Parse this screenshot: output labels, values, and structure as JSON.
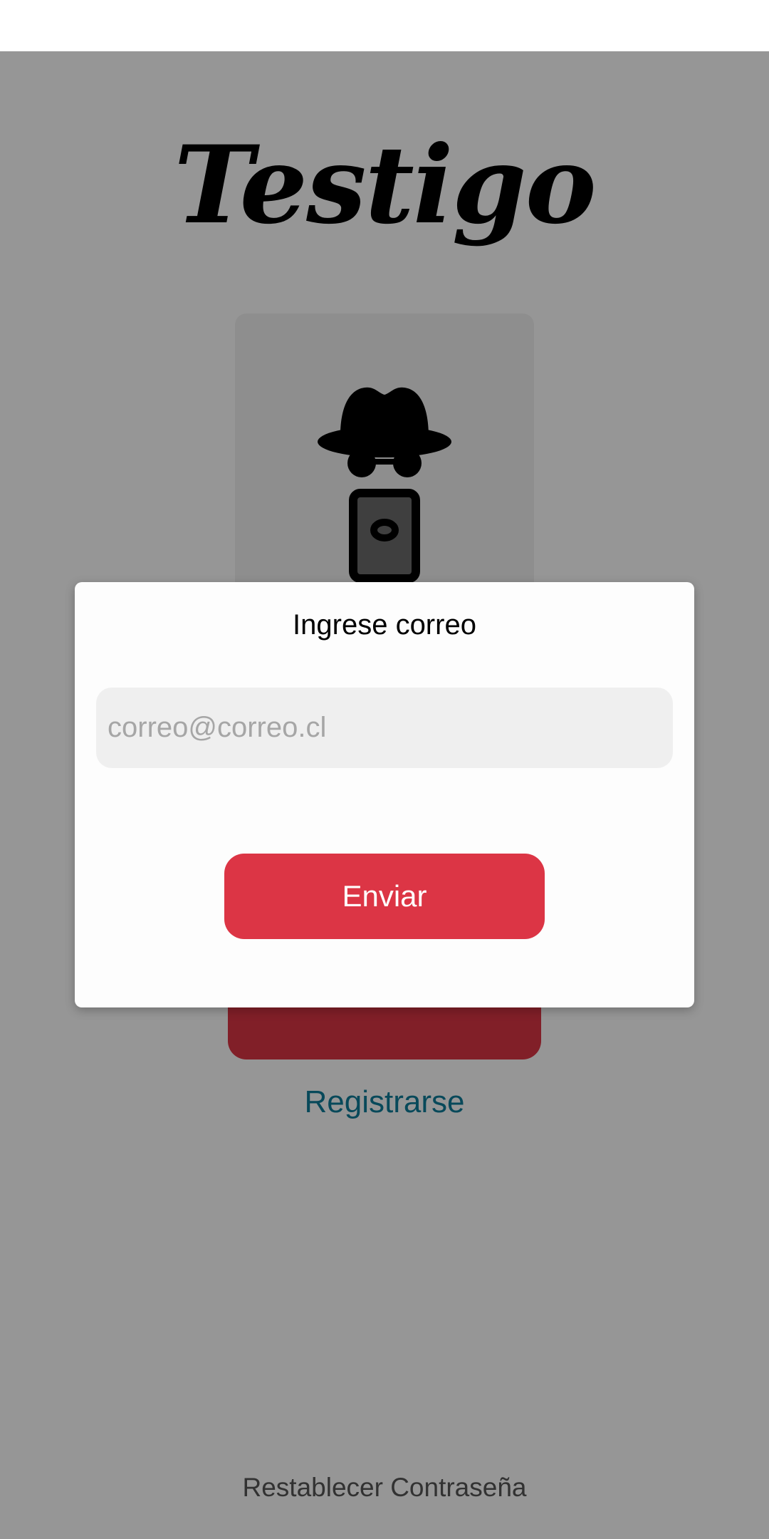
{
  "app": {
    "title": "Testigo"
  },
  "main": {
    "logo_icon": "spy-phone-icon",
    "login_button_label": "",
    "register_link": "Registrarse",
    "reset_password_link": "Restablecer Contraseña"
  },
  "dialog": {
    "title": "Ingrese correo",
    "email_placeholder": "correo@correo.cl",
    "email_value": "",
    "submit_label": "Enviar"
  },
  "colors": {
    "accent": "#dc3545",
    "link": "#0e7c9a",
    "overlay": "rgba(0,0,0,0.41)",
    "input_background": "#efefef"
  }
}
